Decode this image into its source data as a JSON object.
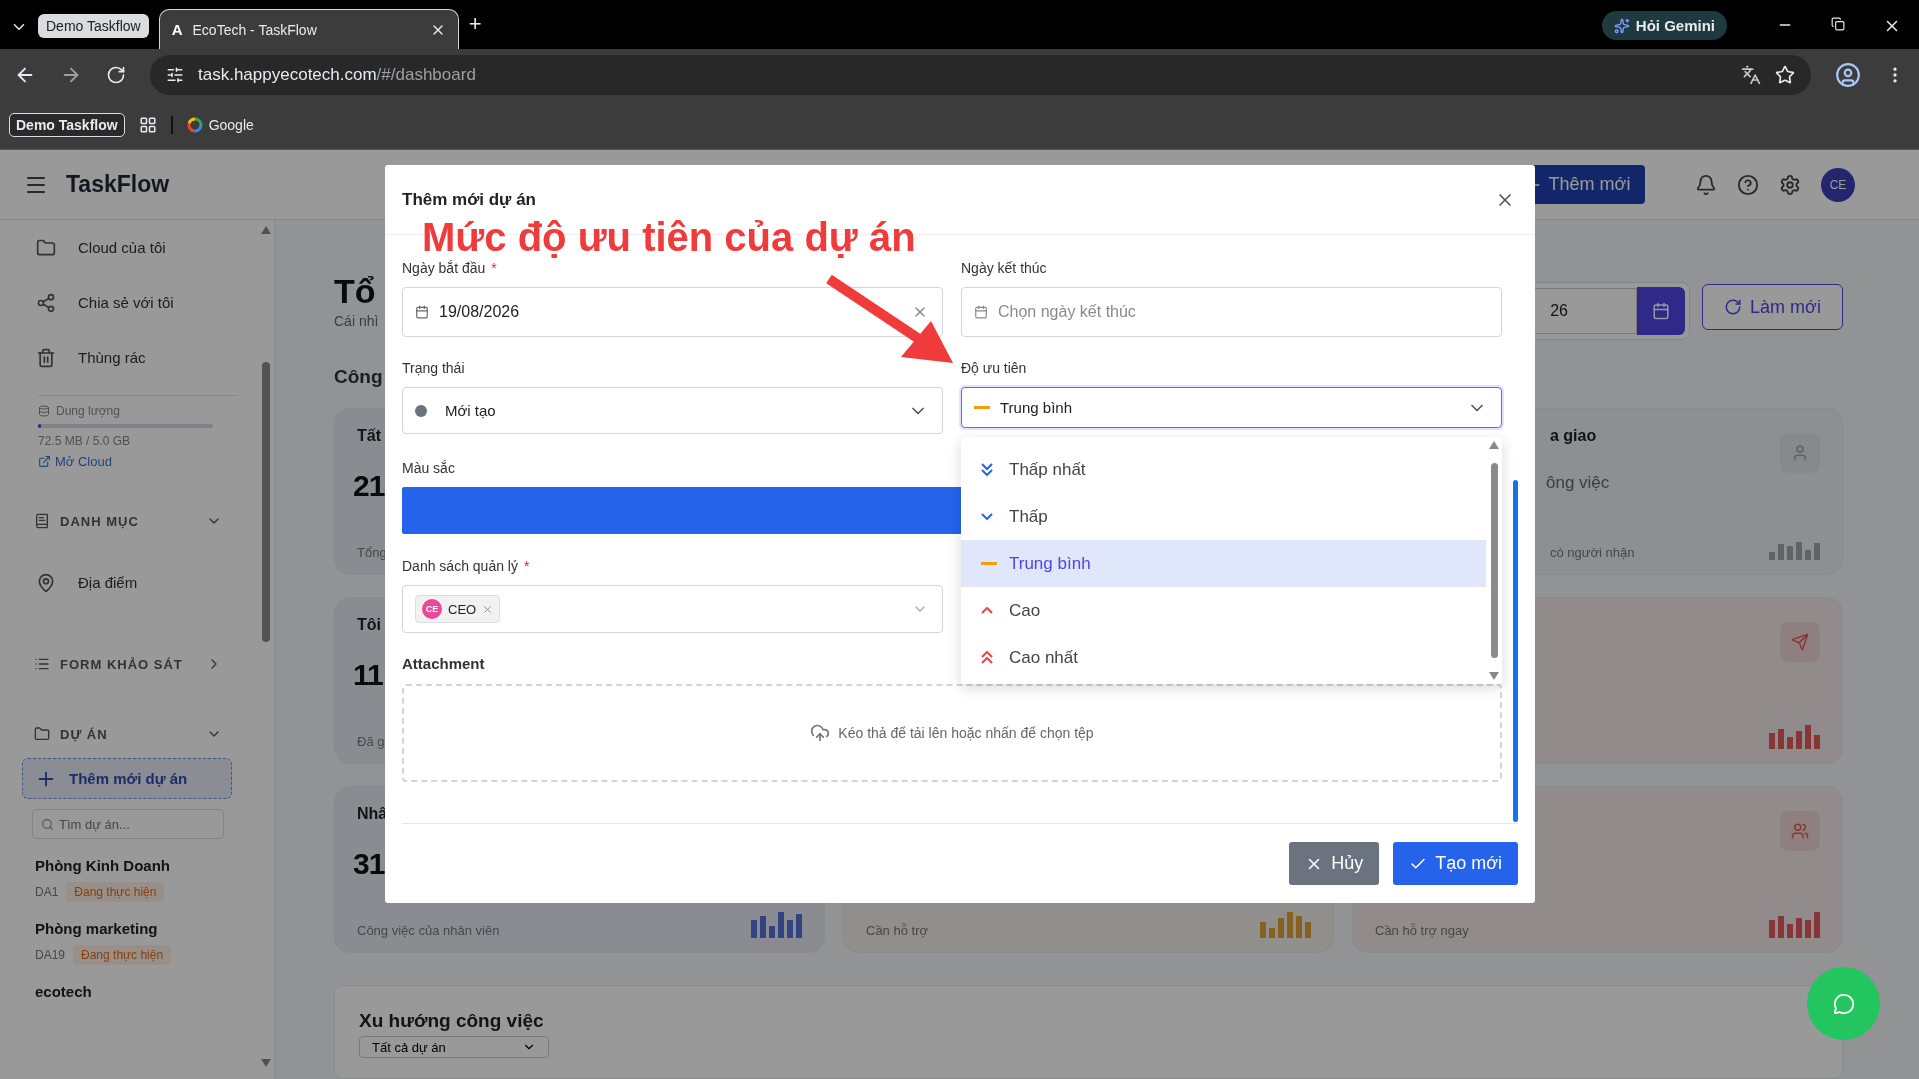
{
  "browser": {
    "tab_group": "Demo Taskflow",
    "tabs": [
      {
        "logo_letter": "A",
        "title": "EcoTech - TaskFlow",
        "selected": true
      }
    ],
    "new_tab": "+",
    "gemini": "Hỏi Gemini",
    "url_host": "task.happyecotech.com",
    "url_path": "/#/dashboard",
    "bookmarks": [
      {
        "label": "Demo Taskflow",
        "kind": "chip"
      },
      {
        "label": "Google",
        "kind": "link"
      }
    ]
  },
  "app": {
    "brand": "TaskFlow",
    "add_button": "Thêm mới",
    "avatar": "CE"
  },
  "sidebar": {
    "items": [
      {
        "label": "Cloud của tôi"
      },
      {
        "label": "Chia sẻ với tôi"
      },
      {
        "label": "Thùng rác"
      }
    ],
    "storage": {
      "label": "Dung lượng",
      "level": 0.015,
      "reading": "72.5 MB / 5.0 GB",
      "link": "Mở Cloud"
    },
    "sections": [
      {
        "label": "DANH MỤC",
        "expanded": true,
        "items": [
          "Địa điểm"
        ]
      },
      {
        "label": "FORM KHẢO SÁT",
        "expanded": false
      },
      {
        "label": "DỰ ÁN",
        "expanded": true
      }
    ],
    "add_project": "Thêm mới dự án",
    "search_placeholder": "Tìm dự án...",
    "projects": [
      {
        "name": "Phòng Kinh Doanh",
        "code": "DA1",
        "status": "Đang thực hiện"
      },
      {
        "name": "Phòng marketing",
        "code": "DA19",
        "status": "Đang thực hiện"
      },
      {
        "name": "ecotech"
      }
    ]
  },
  "dashboard": {
    "title": "Tổ",
    "subtitle": "Cái nhì",
    "section": "Công",
    "date_value": "26",
    "refresh": "Làm mới",
    "cards": [
      {
        "title": "Tất",
        "value": "21",
        "caption": "Tổng",
        "kind": "blue"
      },
      {
        "title": "Tôi",
        "value": "11",
        "caption": "Đã g",
        "kind": "blue"
      },
      {
        "title": "Nhâ",
        "value": "31",
        "caption": "Công việc của nhân viên",
        "kind": "blue"
      },
      {
        "caption": "Cần hỗ trợ",
        "kind": "amber"
      },
      {
        "title": "a giao",
        "value": "ông việc",
        "caption": "có người nhận",
        "kind": "grey"
      },
      {
        "kind": "red"
      },
      {
        "caption": "Cần hỗ trợ ngay",
        "kind": "red"
      }
    ],
    "trend": {
      "title": "Xu hướng công việc",
      "filter": "Tất cả dự án"
    }
  },
  "modal": {
    "title": "Thêm mới dự án",
    "annotation": "Mức độ ưu tiên của dự án",
    "start_date": {
      "label": "Ngày bắt đầu",
      "required_mark": "*",
      "value": "19/08/2026"
    },
    "end_date": {
      "label": "Ngày kết thúc",
      "placeholder": "Chọn ngày kết thúc"
    },
    "status": {
      "label": "Trạng thái",
      "value": "Mới tạo",
      "color": "#6b7280"
    },
    "priority": {
      "label": "Độ ưu tiên",
      "value": "Trung bình",
      "kind": "medium",
      "expanded": true,
      "options": [
        {
          "label": "Thấp nhất",
          "kind": "lowest",
          "selected": false
        },
        {
          "label": "Thấp",
          "kind": "low",
          "selected": false
        },
        {
          "label": "Trung bình",
          "kind": "medium",
          "selected": true
        },
        {
          "label": "Cao",
          "kind": "high",
          "selected": false
        },
        {
          "label": "Cao nhất",
          "kind": "highest",
          "selected": false
        }
      ]
    },
    "color_field": {
      "label": "Màu sắc",
      "color": "#2563eb"
    },
    "managers": {
      "label": "Danh sách quản lý",
      "required_mark": "*",
      "tags": [
        {
          "initials": "CE",
          "label": "CEO"
        }
      ]
    },
    "attachment": {
      "label": "Attachment",
      "hint": "Kéo thả để tải lên hoặc nhấn để chọn tệp"
    },
    "buttons": [
      {
        "label": "Hủy",
        "kind": "cancel"
      },
      {
        "label": "Tạo mới",
        "kind": "primary"
      }
    ]
  }
}
